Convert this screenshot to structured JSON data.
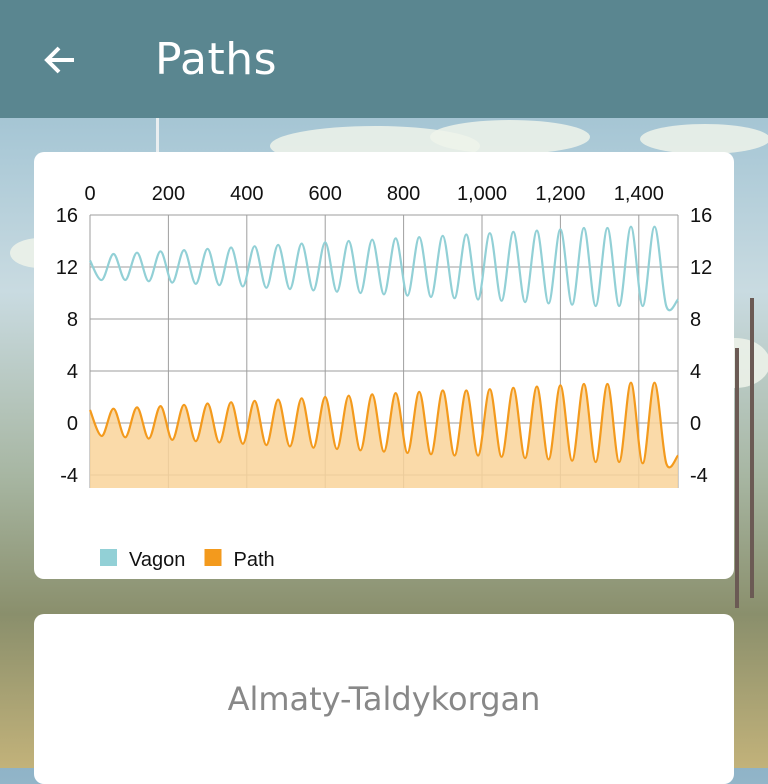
{
  "header": {
    "title": "Paths",
    "back_icon": "arrow-left-icon"
  },
  "colors": {
    "appbar": "#5a8690",
    "vagon": "#92d0d6",
    "path": "#f39a1d",
    "path_fill": "#f9d39a"
  },
  "route": {
    "name": "Almaty-Taldykorgan"
  },
  "chart_data": {
    "type": "line",
    "x_ticks": [
      "0",
      "200",
      "400",
      "600",
      "800",
      "1,000",
      "1,200",
      "1,400"
    ],
    "x_tick_values": [
      0,
      200,
      400,
      600,
      800,
      1000,
      1200,
      1400
    ],
    "y_ticks": [
      "16",
      "12",
      "8",
      "4",
      "0",
      "-4"
    ],
    "y_tick_values": [
      16,
      12,
      8,
      4,
      0,
      -4
    ],
    "xlim": [
      0,
      1500
    ],
    "ylim": [
      -5,
      16
    ],
    "grid": true,
    "legend_position": "bottom-left",
    "series": [
      {
        "name": "Vagon",
        "area": false,
        "description_values": "oscillation centred near 12 with amplitude growing from about 1 to 3",
        "x": [
          0,
          30,
          60,
          90,
          120,
          150,
          180,
          210,
          240,
          270,
          300,
          330,
          360,
          390,
          420,
          450,
          480,
          510,
          540,
          570,
          600,
          630,
          660,
          690,
          720,
          750,
          780,
          810,
          840,
          870,
          900,
          930,
          960,
          990,
          1020,
          1050,
          1080,
          1110,
          1140,
          1170,
          1200,
          1230,
          1260,
          1290,
          1320,
          1350,
          1380,
          1410,
          1440,
          1470,
          1500
        ],
        "y": [
          12.5,
          11.0,
          13.0,
          11.0,
          13.1,
          10.9,
          13.2,
          10.8,
          13.3,
          10.7,
          13.4,
          10.6,
          13.5,
          10.5,
          13.6,
          10.4,
          13.7,
          10.3,
          13.8,
          10.2,
          13.9,
          10.1,
          14.0,
          10.0,
          14.1,
          9.9,
          14.2,
          9.8,
          14.3,
          9.7,
          14.4,
          9.6,
          14.5,
          9.5,
          14.6,
          9.4,
          14.7,
          9.3,
          14.8,
          9.2,
          14.9,
          9.1,
          15.0,
          9.0,
          15.0,
          9.0,
          15.1,
          9.0,
          15.1,
          9.0,
          9.5
        ]
      },
      {
        "name": "Path",
        "area": true,
        "x": [
          0,
          30,
          60,
          90,
          120,
          150,
          180,
          210,
          240,
          270,
          300,
          330,
          360,
          390,
          420,
          450,
          480,
          510,
          540,
          570,
          600,
          630,
          660,
          690,
          720,
          750,
          780,
          810,
          840,
          870,
          900,
          930,
          960,
          990,
          1020,
          1050,
          1080,
          1110,
          1140,
          1170,
          1200,
          1230,
          1260,
          1290,
          1320,
          1350,
          1380,
          1410,
          1440,
          1470,
          1500
        ],
        "y": [
          1.0,
          -1.0,
          1.1,
          -1.1,
          1.2,
          -1.2,
          1.3,
          -1.3,
          1.4,
          -1.4,
          1.5,
          -1.5,
          1.6,
          -1.6,
          1.7,
          -1.7,
          1.8,
          -1.8,
          1.9,
          -1.9,
          2.0,
          -2.0,
          2.1,
          -2.1,
          2.2,
          -2.2,
          2.3,
          -2.3,
          2.4,
          -2.4,
          2.5,
          -2.5,
          2.5,
          -2.5,
          2.6,
          -2.6,
          2.7,
          -2.7,
          2.8,
          -2.8,
          2.9,
          -2.9,
          3.0,
          -3.0,
          3.0,
          -3.0,
          3.1,
          -3.1,
          3.1,
          -3.1,
          -2.5
        ]
      }
    ]
  }
}
